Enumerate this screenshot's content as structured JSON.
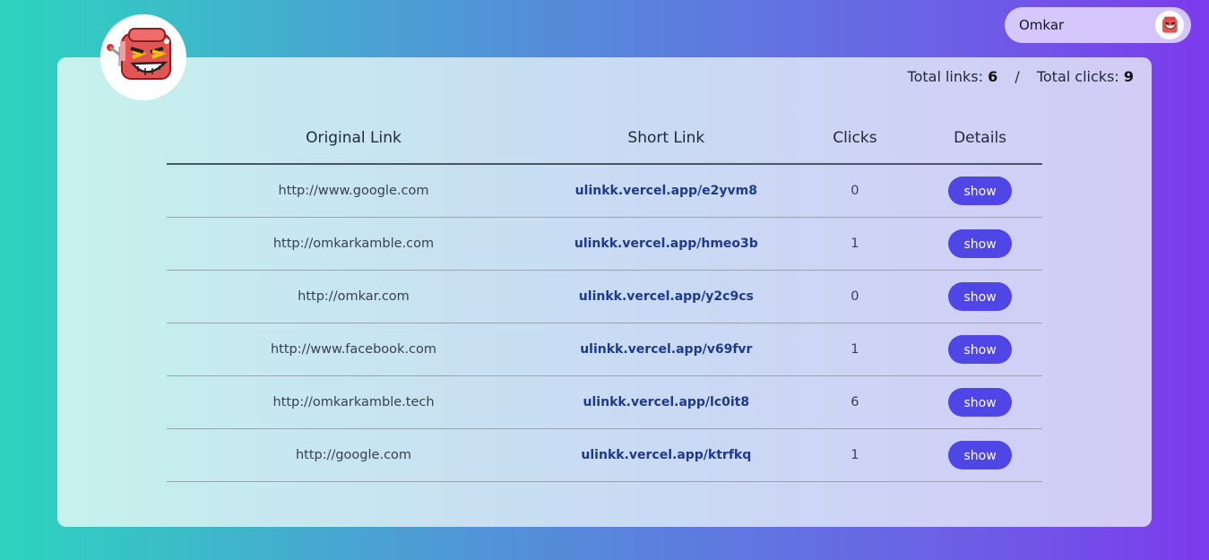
{
  "header": {
    "user_name": "Omkar",
    "avatar_icon": "robot-mascot-icon"
  },
  "logo": {
    "icon": "robot-mascot-icon"
  },
  "totals": {
    "links_label": "Total links:",
    "links_value": "6",
    "separator": "/",
    "clicks_label": "Total clicks:",
    "clicks_value": "9"
  },
  "table": {
    "headers": [
      "Original Link",
      "Short Link",
      "Clicks",
      "Details"
    ],
    "rows": [
      {
        "original": "http://www.google.com",
        "short": "ulinkk.vercel.app/e2yvm8",
        "clicks": "0",
        "action": "show"
      },
      {
        "original": "http://omkarkamble.com",
        "short": "ulinkk.vercel.app/hmeo3b",
        "clicks": "1",
        "action": "show"
      },
      {
        "original": "http://omkar.com",
        "short": "ulinkk.vercel.app/y2c9cs",
        "clicks": "0",
        "action": "show"
      },
      {
        "original": "http://www.facebook.com",
        "short": "ulinkk.vercel.app/v69fvr",
        "clicks": "1",
        "action": "show"
      },
      {
        "original": "http://omkarkamble.tech",
        "short": "ulinkk.vercel.app/lc0it8",
        "clicks": "6",
        "action": "show"
      },
      {
        "original": "http://google.com",
        "short": "ulinkk.vercel.app/ktrfkq",
        "clicks": "1",
        "action": "show"
      }
    ]
  },
  "colors": {
    "accent": "#4f46e5",
    "link": "#1e3a8a",
    "gradient_start": "#2dd4bf",
    "gradient_end": "#7c3aed"
  }
}
